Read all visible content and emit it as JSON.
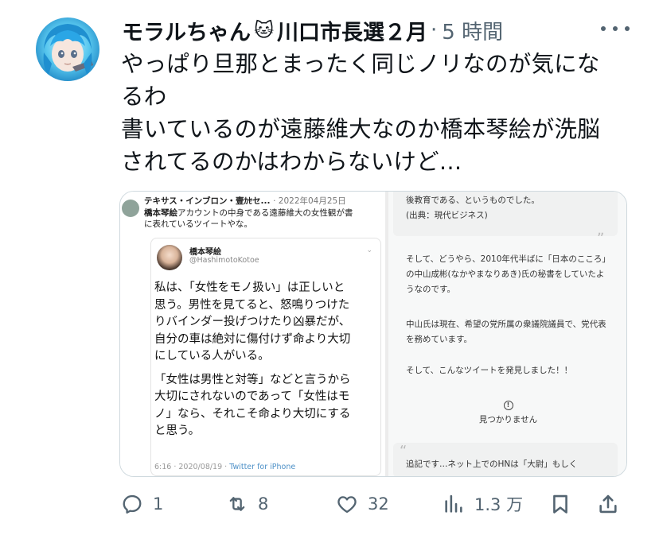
{
  "author": {
    "display_name": "モラルちゃん",
    "emoji": "🐱",
    "name_suffix": "川口市長選２月",
    "separator": "·",
    "timestamp": "5 時間"
  },
  "tweet": {
    "lines": [
      "やっぱり旦那とまったく同じノリなのが気にな",
      "るわ",
      "書いているのが遠藤維大なのか橋本琴絵が洗脳",
      "されてるのかはわからないけど…"
    ]
  },
  "media": {
    "left": {
      "header_name": "テキサス・インブロン・壹ｶｾセ...",
      "header_date": "· 2022年04月25日",
      "header_line1_bold": "橋本琴絵",
      "header_line1_rest": "アカウントの中身である遠藤維大の女性観が書",
      "header_line2": "に表れているツイートやな。",
      "quoted": {
        "name": "橋本琴絵",
        "handle": "@HashimotoKotoe",
        "chevron": "⌄",
        "para1": [
          "私は、「女性をモノ扱い」は正しいと",
          "思う。男性を見てると、怒鳴りつけた",
          "りバインダー投げつけたり凶暴だが、",
          "自分の車は絶対に傷付けず命より大切",
          "にしている人がいる。"
        ],
        "para2": [
          "「女性は男性と対等」などと言うから",
          "大切にされないのであって「女性はモ",
          "ノ」なら、それこそ命より大切にする",
          "と思う。"
        ],
        "footer_time": "6:16 · 2020/08/19 · ",
        "footer_source": "Twitter for iPhone"
      }
    },
    "right": {
      "top_lines": [
        "後教育である、というものでした。",
        "(出典：現代ビジネス)"
      ],
      "quote_close": "„",
      "mid_lines": [
        "そして、どうやら、2010年代半ばに「日本のこころ」",
        "の中山成彬(なかやまなりあき)氏の秘書をしていたよ",
        "うなのです。"
      ],
      "mid2_lines": [
        "中山氏は現在、希望の党所属の衆議院議員で、党代表",
        "を務めています。"
      ],
      "mid3_line": "そして、こんなツイートを発見しました！！",
      "alert_icon": "!",
      "alert_text": "見つかりません",
      "quote_open": "“",
      "bottom_line": "追記です…ネット上でのHNは「大尉」もしく"
    }
  },
  "actions": {
    "reply_count": "1",
    "retweet_count": "8",
    "like_count": "32",
    "views_count": "1.3 万"
  }
}
